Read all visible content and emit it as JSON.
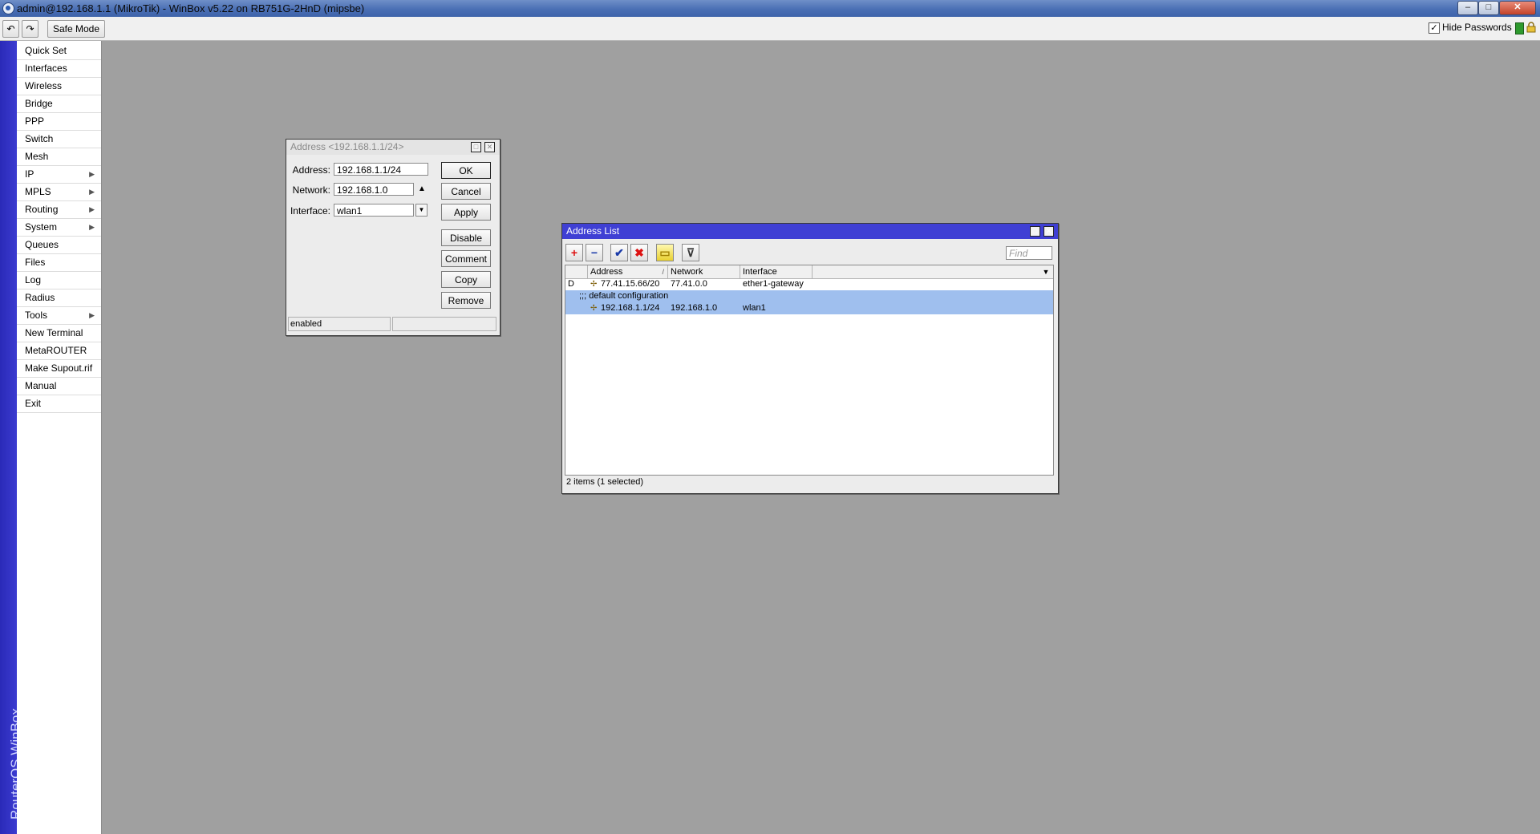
{
  "window": {
    "title": "admin@192.168.1.1 (MikroTik) - WinBox v5.22 on RB751G-2HnD (mipsbe)",
    "min_glyph": "–",
    "max_glyph": "□",
    "close_glyph": "✕"
  },
  "toolbar": {
    "undo_glyph": "↶",
    "redo_glyph": "↷",
    "safe_mode_label": "Safe Mode",
    "hide_passwords_label": "Hide Passwords",
    "hide_passwords_checked": true,
    "check_glyph": "✓"
  },
  "brand": "RouterOS WinBox",
  "sidebar": {
    "items": [
      {
        "label": "Quick Set",
        "submenu": ""
      },
      {
        "label": "Interfaces",
        "submenu": ""
      },
      {
        "label": "Wireless",
        "submenu": ""
      },
      {
        "label": "Bridge",
        "submenu": ""
      },
      {
        "label": "PPP",
        "submenu": ""
      },
      {
        "label": "Switch",
        "submenu": ""
      },
      {
        "label": "Mesh",
        "submenu": ""
      },
      {
        "label": "IP",
        "submenu": "▶"
      },
      {
        "label": "MPLS",
        "submenu": "▶"
      },
      {
        "label": "Routing",
        "submenu": "▶"
      },
      {
        "label": "System",
        "submenu": "▶"
      },
      {
        "label": "Queues",
        "submenu": ""
      },
      {
        "label": "Files",
        "submenu": ""
      },
      {
        "label": "Log",
        "submenu": ""
      },
      {
        "label": "Radius",
        "submenu": ""
      },
      {
        "label": "Tools",
        "submenu": "▶"
      },
      {
        "label": "New Terminal",
        "submenu": ""
      },
      {
        "label": "MetaROUTER",
        "submenu": ""
      },
      {
        "label": "Make Supout.rif",
        "submenu": ""
      },
      {
        "label": "Manual",
        "submenu": ""
      },
      {
        "label": "Exit",
        "submenu": ""
      }
    ]
  },
  "address_dialog": {
    "title": "Address <192.168.1.1/24>",
    "restore_glyph": "□",
    "close_glyph": "✕",
    "address_label": "Address:",
    "address_value": "192.168.1.1/24",
    "network_label": "Network:",
    "network_value": "192.168.1.0",
    "network_toggle_glyph": "▲",
    "interface_label": "Interface:",
    "interface_value": "wlan1",
    "interface_dropdown_glyph": "▼",
    "buttons": {
      "ok": "OK",
      "cancel": "Cancel",
      "apply": "Apply",
      "disable": "Disable",
      "comment": "Comment",
      "copy": "Copy",
      "remove": "Remove"
    },
    "status": "enabled"
  },
  "address_list": {
    "title": "Address List",
    "restore_glyph": "□",
    "close_glyph": "✕",
    "toolbar_glyphs": {
      "add": "+",
      "remove": "−",
      "enable": "✔",
      "disable": "✖",
      "comment": "▭",
      "filter": "⊽"
    },
    "find_placeholder": "Find",
    "columns": {
      "flags": "",
      "address": "Address",
      "sort": "/",
      "network": "Network",
      "interface": "Interface",
      "menu_glyph": "▼"
    },
    "rows": [
      {
        "flag": "D",
        "icon": "✢",
        "address": "77.41.15.66/20",
        "network": "77.41.0.0",
        "interface": "ether1-gateway"
      },
      {
        "comment": ";;; default configuration"
      },
      {
        "flag": "",
        "icon": "✢",
        "address": "192.168.1.1/24",
        "network": "192.168.1.0",
        "interface": "wlan1"
      }
    ],
    "status": "2 items (1 selected)"
  },
  "colors": {
    "desktop": "#a0a0a0",
    "dialog_title_active": "#3f3fd4",
    "dialog_title_inactive": "#e4e4e4",
    "selected_row": "#9fbfee"
  }
}
